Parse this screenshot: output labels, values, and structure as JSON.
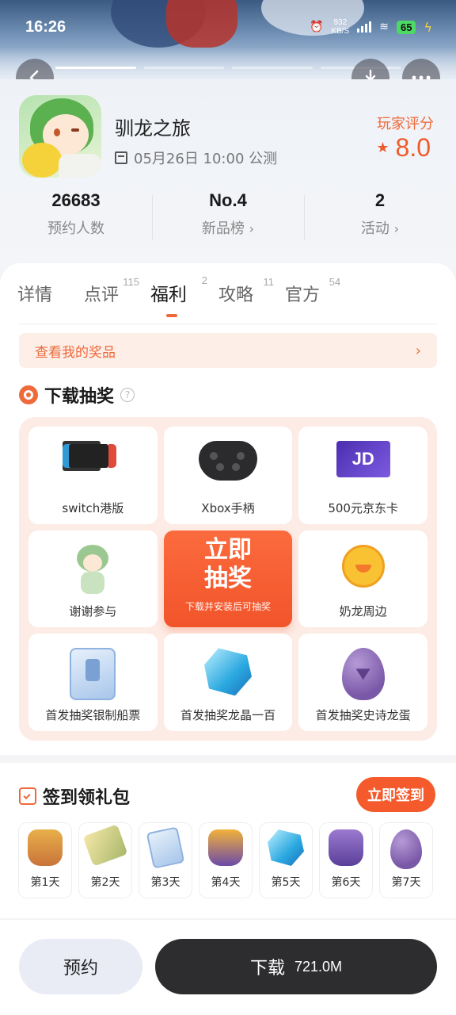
{
  "status_bar": {
    "time": "16:26",
    "net_speed": "932",
    "net_unit": "KB/S",
    "battery": "65"
  },
  "nav": {
    "back_icon": "back-arrow-icon",
    "download_icon": "download-icon",
    "more_icon": "more-dots-icon"
  },
  "app": {
    "name": "驯龙之旅",
    "launch": "05月26日 10:00 公测",
    "rating_label": "玩家评分",
    "rating": "8.0"
  },
  "stats": [
    {
      "value": "26683",
      "label": "预约人数",
      "chevron": ""
    },
    {
      "value": "No.4",
      "label": "新品榜",
      "chevron": "›"
    },
    {
      "value": "2",
      "label": "活动",
      "chevron": "›"
    }
  ],
  "tabs": [
    {
      "label": "详情",
      "count": ""
    },
    {
      "label": "点评",
      "count": "115"
    },
    {
      "label": "福利",
      "count": "2"
    },
    {
      "label": "攻略",
      "count": "11"
    },
    {
      "label": "官方",
      "count": "54"
    }
  ],
  "prize_bar": {
    "label": "查看我的奖品",
    "arrow": "›"
  },
  "lottery": {
    "title": "下载抽奖",
    "help": "?",
    "prizes": [
      {
        "label": "switch港版",
        "icon": "switch-console-icon"
      },
      {
        "label": "Xbox手柄",
        "icon": "gamepad-icon"
      },
      {
        "label": "500元京东卡",
        "icon": "gift-card-icon"
      },
      {
        "label": "谢谢参与",
        "icon": "chibi-character-icon"
      },
      {
        "label": "奶龙周边",
        "icon": "duck-mascot-icon"
      },
      {
        "label": "首发抽奖银制船票",
        "icon": "ticket-icon"
      },
      {
        "label": "首发抽奖龙晶一百",
        "icon": "crystal-icon"
      },
      {
        "label": "首发抽奖史诗龙蛋",
        "icon": "dragon-egg-icon"
      }
    ],
    "draw_button": {
      "line1": "立即",
      "line2": "抽奖",
      "note": "下载并安装后可抽奖"
    },
    "card_text": "JD"
  },
  "signin": {
    "title": "签到领礼包",
    "button": "立即签到",
    "days": [
      {
        "label": "第1天",
        "icon": "treasure-bag-icon"
      },
      {
        "label": "第2天",
        "icon": "gold-bars-icon"
      },
      {
        "label": "第3天",
        "icon": "ticket-icon"
      },
      {
        "label": "第4天",
        "icon": "treasure-bag-icon"
      },
      {
        "label": "第5天",
        "icon": "crystal-icon"
      },
      {
        "label": "第6天",
        "icon": "treasure-bag-icon"
      },
      {
        "label": "第7天",
        "icon": "dragon-egg-icon"
      }
    ]
  },
  "bottom": {
    "reserve": "预约",
    "download": "下载",
    "size": "721.0M"
  },
  "colors": {
    "accent": "#EF6A3A",
    "download_button": "#2D2D2F",
    "reserve_button": "#E9EBF5"
  }
}
